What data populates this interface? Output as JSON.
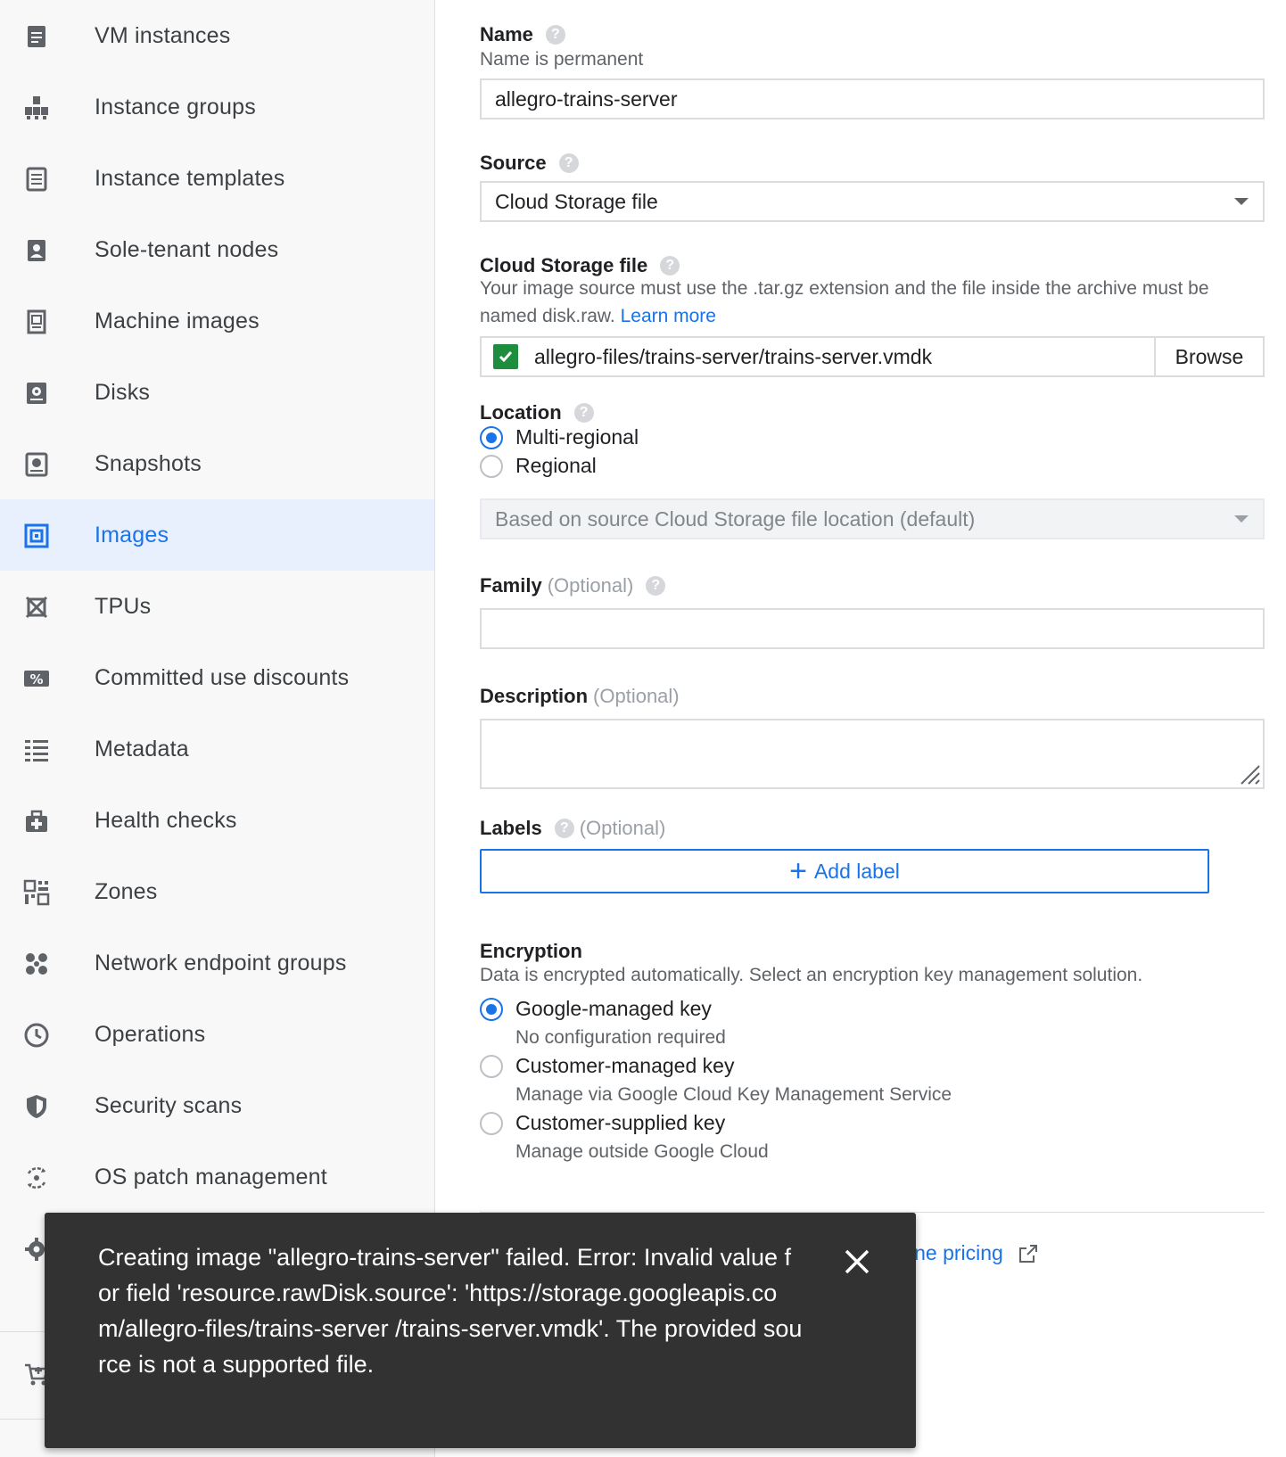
{
  "sidebar": {
    "items": [
      {
        "label": "VM instances",
        "icon": "vm-instances-icon"
      },
      {
        "label": "Instance groups",
        "icon": "instance-groups-icon"
      },
      {
        "label": "Instance templates",
        "icon": "instance-templates-icon"
      },
      {
        "label": "Sole-tenant nodes",
        "icon": "sole-tenant-nodes-icon"
      },
      {
        "label": "Machine images",
        "icon": "machine-images-icon"
      },
      {
        "label": "Disks",
        "icon": "disks-icon"
      },
      {
        "label": "Snapshots",
        "icon": "snapshots-icon"
      },
      {
        "label": "Images",
        "icon": "images-icon",
        "active": true
      },
      {
        "label": "TPUs",
        "icon": "tpus-icon"
      },
      {
        "label": "Committed use discounts",
        "icon": "percent-icon"
      },
      {
        "label": "Metadata",
        "icon": "metadata-list-icon"
      },
      {
        "label": "Health checks",
        "icon": "health-checks-icon"
      },
      {
        "label": "Zones",
        "icon": "zones-grid-icon"
      },
      {
        "label": "Network endpoint groups",
        "icon": "network-endpoint-icon"
      },
      {
        "label": "Operations",
        "icon": "clock-icon"
      },
      {
        "label": "Security scans",
        "icon": "shield-icon"
      },
      {
        "label": "OS patch management",
        "icon": "os-patch-icon"
      }
    ]
  },
  "form": {
    "name": {
      "label": "Name",
      "hint": "Name is permanent",
      "value": "allegro-trains-server"
    },
    "source": {
      "label": "Source",
      "value": "Cloud Storage file"
    },
    "storage_file": {
      "label": "Cloud Storage file",
      "hint": "Your image source must use the .tar.gz extension and the file inside the archive must be named disk.raw.",
      "link": "Learn more",
      "value": "allegro-files/trains-server/trains-server.vmdk",
      "browse": "Browse"
    },
    "location": {
      "label": "Location",
      "options": [
        "Multi-regional",
        "Regional"
      ],
      "selected": "Multi-regional",
      "dropdown": "Based on source Cloud Storage file location (default)"
    },
    "family": {
      "label": "Family",
      "optional": "(Optional)",
      "value": ""
    },
    "description": {
      "label": "Description",
      "optional": "(Optional)",
      "value": ""
    },
    "labels": {
      "label": "Labels",
      "optional": "(Optional)",
      "add_label": "Add label"
    },
    "encryption": {
      "label": "Encryption",
      "hint": "Data is encrypted automatically. Select an encryption key management solution.",
      "options": [
        {
          "label": "Google-managed key",
          "sub": "No configuration required",
          "selected": true
        },
        {
          "label": "Customer-managed key",
          "sub": "Manage via Google Cloud Key Management Service",
          "selected": false
        },
        {
          "label": "Customer-supplied key",
          "sub": "Manage outside Google Cloud",
          "selected": false
        }
      ]
    },
    "pricing_link": "ine pricing"
  },
  "toast": {
    "message": "Creating image \"allegro-trains-server\" failed. Error: Invalid value for field 'resource.rawDisk.source': 'https://storage.googleapis.com/allegro-files/trains-server /trains-server.vmdk'. The provided source is not a supported file."
  },
  "colors": {
    "accent": "#1a73e8",
    "check": "#1e8e3e",
    "toast_bg": "#323232"
  }
}
